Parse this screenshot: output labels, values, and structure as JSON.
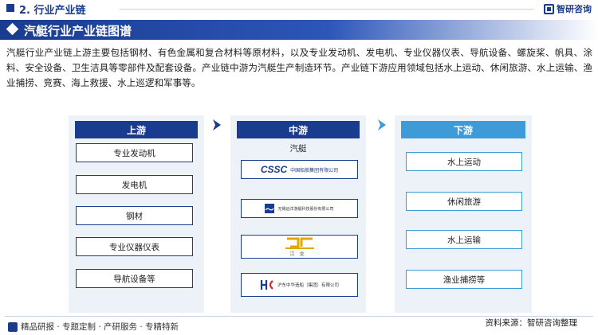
{
  "header": {
    "section_title": "2. 行业产业链",
    "brand_name": "智研咨询"
  },
  "banner": {
    "title": "汽艇行业产业链图谱"
  },
  "intro": "汽艇行业产业链上游主要包括钢材、有色金属和复合材料等原材料，以及专业发动机、发电机、专业仪器仪表、导航设备、螺旋桨、帆具、涂料、安全设备、卫生洁具等零部件及配套设备。产业链中游为汽艇生产制造环节。产业链下游应用领域包括水上运动、休闲旅游、水上运输、渔业捕捞、竞赛、海上救援、水上巡逻和军事等。",
  "diagram": {
    "upstream": {
      "title": "上游",
      "items": [
        "专业发动机",
        "发电机",
        "钢材",
        "专业仪器仪表",
        "导航设备等"
      ]
    },
    "midstream": {
      "title": "中游",
      "label": "汽艇",
      "logos": [
        {
          "mark": "CSSC",
          "name": "中国船舶集团有限公司"
        },
        {
          "mark": "",
          "name": "无锡远洋游艇科技股份有限公司"
        },
        {
          "mark": "江龙",
          "name": ""
        },
        {
          "mark": "",
          "name": "沪东中华造船（集团）有限公司"
        }
      ]
    },
    "downstream": {
      "title": "下游",
      "items": [
        "水上运动",
        "休闲旅游",
        "水上运输",
        "渔业捕捞等"
      ]
    }
  },
  "source": "资料来源：智研咨询整理",
  "footer": {
    "tagline": "精品研报 · 专题定制 · 产研服务 · 专精特新"
  },
  "colors": {
    "primary": "#1a3c8f",
    "accent": "#3f9bd8",
    "panel": "#edf1f8"
  }
}
